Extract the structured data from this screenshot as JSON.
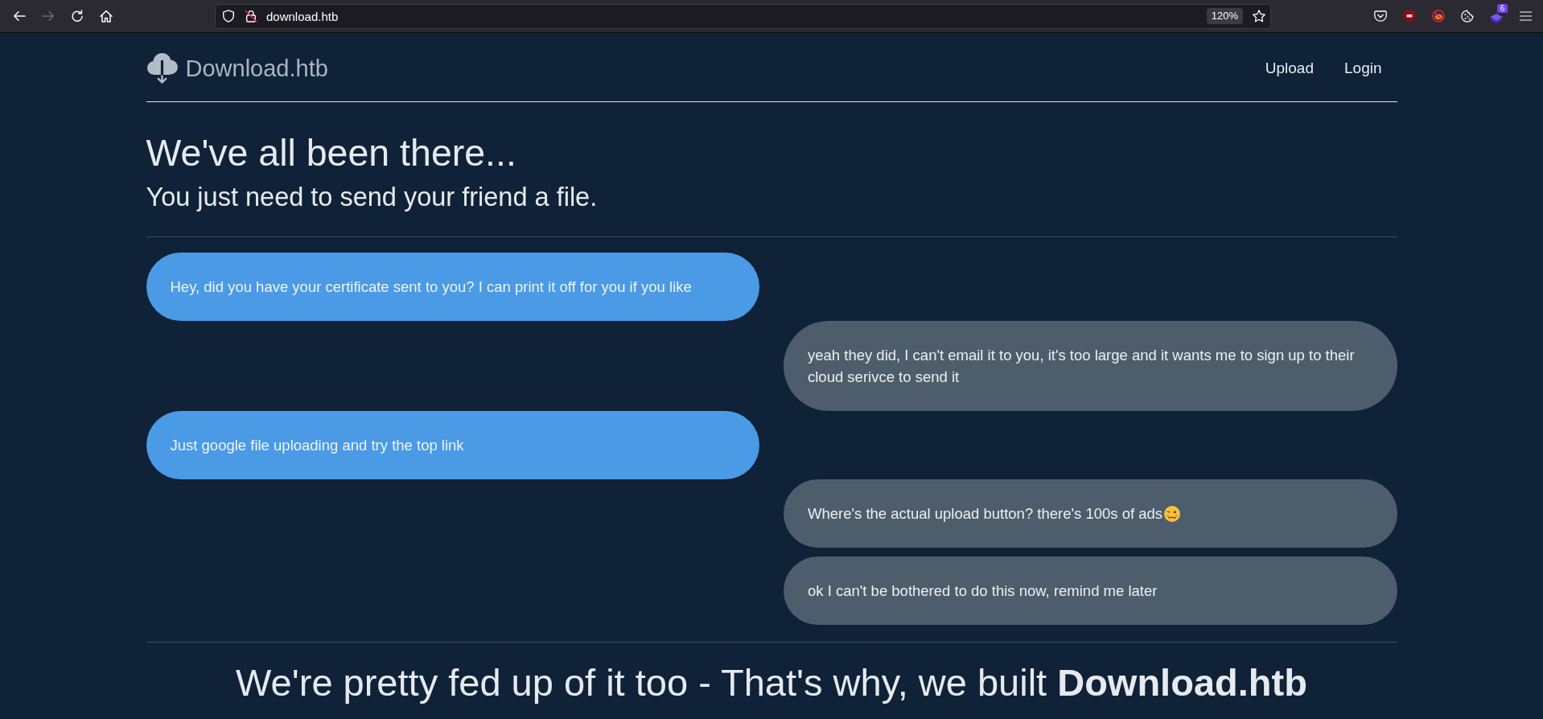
{
  "browser": {
    "nav_buttons": [
      {
        "kind": "back",
        "disabled": false
      },
      {
        "kind": "forward",
        "disabled": true
      },
      {
        "kind": "reload",
        "disabled": false
      },
      {
        "kind": "home",
        "disabled": false
      }
    ],
    "address_bar": {
      "url": "download.htb",
      "zoom": "120%"
    },
    "extension_badge": "6"
  },
  "site": {
    "brand": "Download.htb",
    "nav_links": [
      {
        "label": "Upload"
      },
      {
        "label": "Login"
      }
    ]
  },
  "hero": {
    "title": "We've all been there...",
    "subtitle": "You just need to send your friend a file."
  },
  "chat": [
    {
      "from_me": false,
      "text": "Hey, did you have your certificate sent to you? I can print it off for you if you like"
    },
    {
      "from_me": true,
      "text": "yeah they did, I can't email it to you, it's too large and it wants me to sign up to their cloud serivce to send it"
    },
    {
      "from_me": false,
      "text": "Just google file uploading and try the top link"
    },
    {
      "from_me": true,
      "text": "Where's the actual upload button? there's 100s of ads",
      "emoji": true
    },
    {
      "from_me": true,
      "text": "ok I can't be bothered to do this now, remind me later"
    }
  ],
  "tagline": "We're pretty fed up of it too - That's why, we built **Download.htb**"
}
